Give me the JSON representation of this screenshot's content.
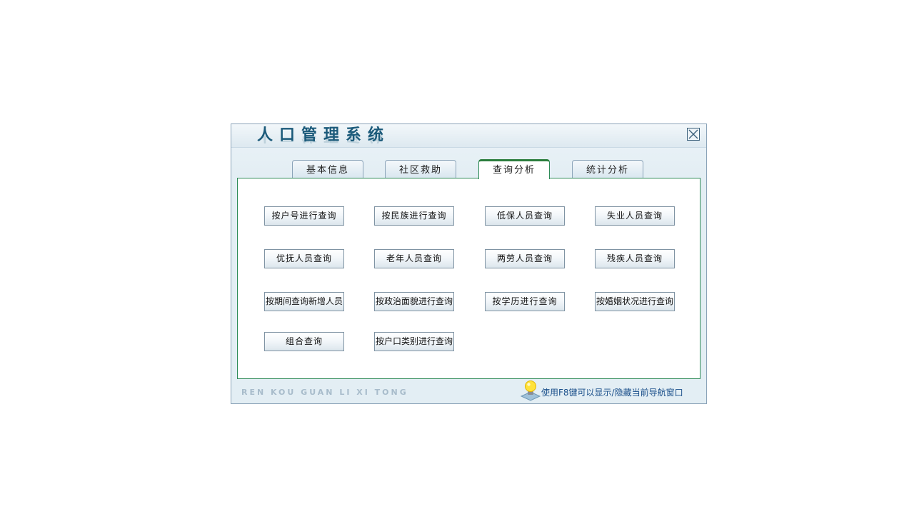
{
  "window": {
    "title": "人口管理系统",
    "close_label": "关闭"
  },
  "tabs": [
    {
      "label": "基本信息",
      "active": false
    },
    {
      "label": "社区救助",
      "active": false
    },
    {
      "label": "查询分析",
      "active": true
    },
    {
      "label": "统计分析",
      "active": false
    }
  ],
  "queries": [
    [
      "按户号进行查询",
      "按民族进行查询",
      "低保人员查询",
      "失业人员查询"
    ],
    [
      "优抚人员查询",
      "老年人员查询",
      "两劳人员查询",
      "残疾人员查询"
    ],
    [
      "按期间查询新增人员",
      "按政治面貌进行查询",
      "按学历进行查询",
      "按婚姻状况进行查询"
    ],
    [
      "组合查询",
      "按户口类别进行查询"
    ]
  ],
  "footer": {
    "pinyin": "REN KOU GUAN LI XI TONG",
    "hint": "使用F8键可以显示/隐藏当前导航窗口",
    "hint_icon": "lightbulb-icon"
  },
  "colors": {
    "title": "#1b5a7a",
    "active_tab_border": "#2a7d3c",
    "hint_text": "#1a4f8a"
  }
}
